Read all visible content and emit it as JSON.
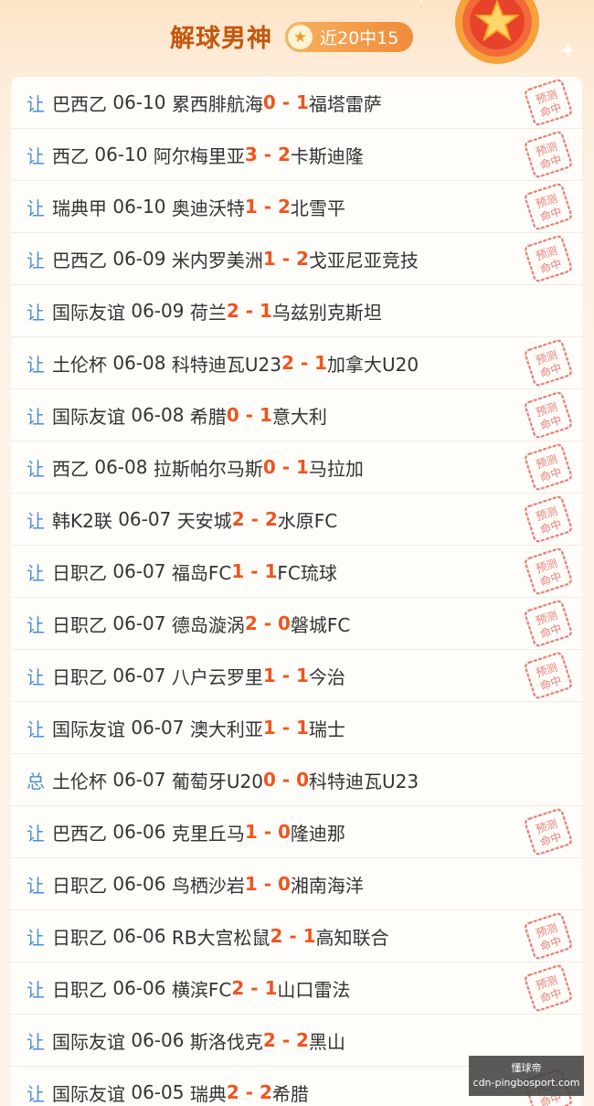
{
  "header": {
    "title": "解球男神",
    "badge": "近20中15"
  },
  "stamp_text": [
    "预测",
    "命中"
  ],
  "colors": {
    "accent": "#f0541c",
    "type": "#4a8fd6",
    "title": "#c5560c"
  },
  "matches": [
    {
      "type": "让",
      "league": "巴西乙",
      "date": "06-10",
      "home": "累西腓航海",
      "hs": "0",
      "as": "1",
      "away": "福塔雷萨",
      "hit": true
    },
    {
      "type": "让",
      "league": "西乙",
      "date": "06-10",
      "home": "阿尔梅里亚",
      "hs": "3",
      "as": "2",
      "away": "卡斯迪隆",
      "hit": true
    },
    {
      "type": "让",
      "league": "瑞典甲",
      "date": "06-10",
      "home": "奥迪沃特",
      "hs": "1",
      "as": "2",
      "away": "北雪平",
      "hit": true
    },
    {
      "type": "让",
      "league": "巴西乙",
      "date": "06-09",
      "home": "米内罗美洲",
      "hs": "1",
      "as": "2",
      "away": "戈亚尼亚竞技",
      "hit": true
    },
    {
      "type": "让",
      "league": "国际友谊",
      "date": "06-09",
      "home": "荷兰",
      "hs": "2",
      "as": "1",
      "away": "乌兹别克斯坦",
      "hit": false
    },
    {
      "type": "让",
      "league": "土伦杯",
      "date": "06-08",
      "home": "科特迪瓦U23",
      "hs": "2",
      "as": "1",
      "away": "加拿大U20",
      "hit": true
    },
    {
      "type": "让",
      "league": "国际友谊",
      "date": "06-08",
      "home": "希腊",
      "hs": "0",
      "as": "1",
      "away": "意大利",
      "hit": true
    },
    {
      "type": "让",
      "league": "西乙",
      "date": "06-08",
      "home": "拉斯帕尔马斯",
      "hs": "0",
      "as": "1",
      "away": "马拉加",
      "hit": true
    },
    {
      "type": "让",
      "league": "韩K2联",
      "date": "06-07",
      "home": "天安城",
      "hs": "2",
      "as": "2",
      "away": "水原FC",
      "hit": true
    },
    {
      "type": "让",
      "league": "日职乙",
      "date": "06-07",
      "home": "福岛FC",
      "hs": "1",
      "as": "1",
      "away": "FC琉球",
      "hit": true
    },
    {
      "type": "让",
      "league": "日职乙",
      "date": "06-07",
      "home": "德岛漩涡",
      "hs": "2",
      "as": "0",
      "away": "磐城FC",
      "hit": true
    },
    {
      "type": "让",
      "league": "日职乙",
      "date": "06-07",
      "home": "八户云罗里",
      "hs": "1",
      "as": "1",
      "away": "今治",
      "hit": true
    },
    {
      "type": "让",
      "league": "国际友谊",
      "date": "06-07",
      "home": "澳大利亚",
      "hs": "1",
      "as": "1",
      "away": "瑞士",
      "hit": false
    },
    {
      "type": "总",
      "league": "土伦杯",
      "date": "06-07",
      "home": "葡萄牙U20",
      "hs": "0",
      "as": "0",
      "away": "科特迪瓦U23",
      "hit": false
    },
    {
      "type": "让",
      "league": "巴西乙",
      "date": "06-06",
      "home": "克里丘马",
      "hs": "1",
      "as": "0",
      "away": "隆迪那",
      "hit": true
    },
    {
      "type": "让",
      "league": "日职乙",
      "date": "06-06",
      "home": "鸟栖沙岩",
      "hs": "1",
      "as": "0",
      "away": "湘南海洋",
      "hit": false
    },
    {
      "type": "让",
      "league": "日职乙",
      "date": "06-06",
      "home": "RB大宫松鼠",
      "hs": "2",
      "as": "1",
      "away": "高知联合",
      "hit": true
    },
    {
      "type": "让",
      "league": "日职乙",
      "date": "06-06",
      "home": "横滨FC",
      "hs": "2",
      "as": "1",
      "away": "山口雷法",
      "hit": true
    },
    {
      "type": "让",
      "league": "国际友谊",
      "date": "06-06",
      "home": "斯洛伐克",
      "hs": "2",
      "as": "2",
      "away": "黑山",
      "hit": false
    },
    {
      "type": "让",
      "league": "国际友谊",
      "date": "06-05",
      "home": "瑞典",
      "hs": "2",
      "as": "2",
      "away": "希腊",
      "hit": true
    }
  ],
  "watermark": {
    "line1": "懂球帝",
    "line2": "cdn-pingbosport.com"
  }
}
